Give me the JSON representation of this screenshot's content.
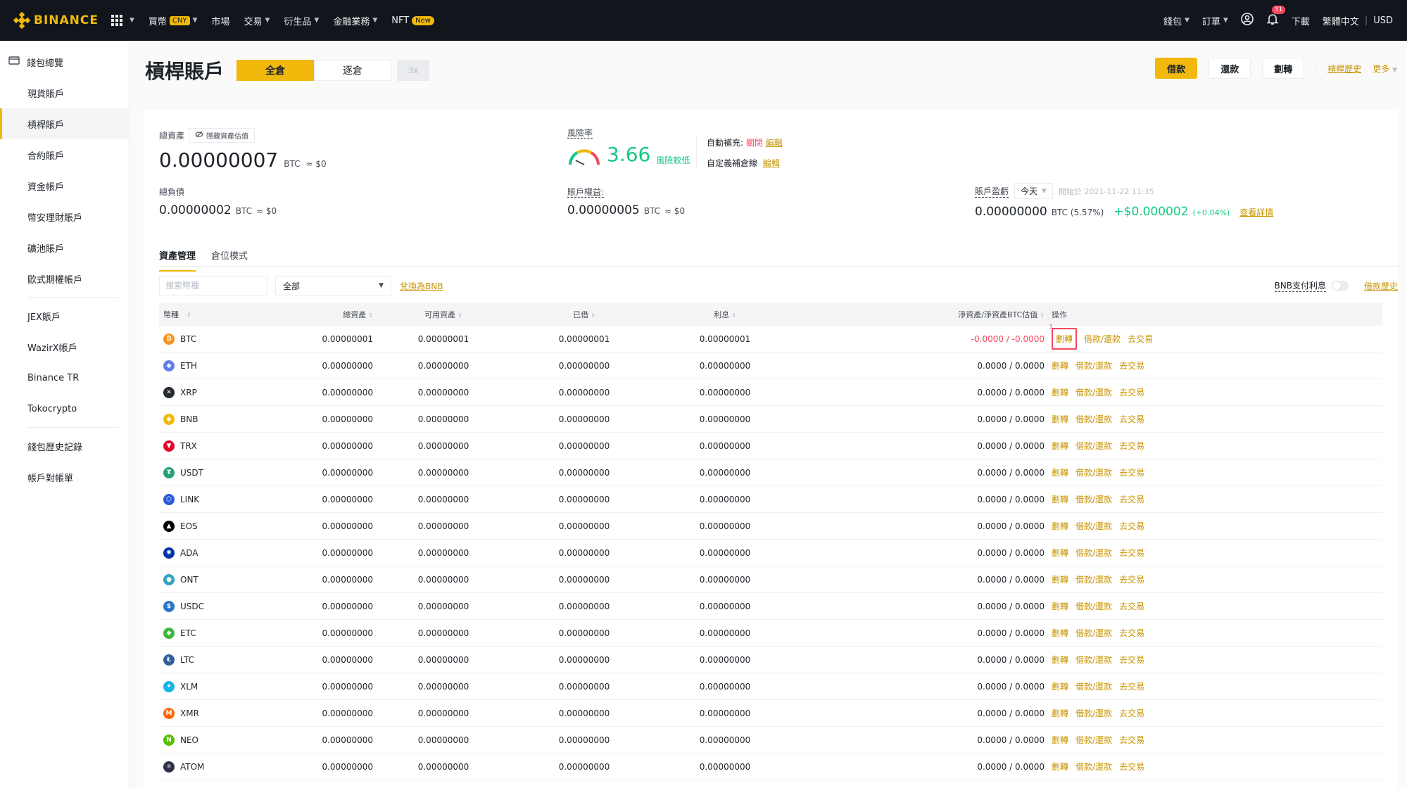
{
  "topbar": {
    "brand": "BINANCE",
    "nav": [
      {
        "label": "買幣",
        "tag": "CNY",
        "caret": true
      },
      {
        "label": "市場",
        "caret": false
      },
      {
        "label": "交易",
        "caret": true
      },
      {
        "label": "衍生品",
        "caret": true
      },
      {
        "label": "金融業務",
        "caret": true
      },
      {
        "label": "NFT",
        "tag": "New",
        "caret": false
      }
    ],
    "right": {
      "wallet": "錢包",
      "orders": "訂單",
      "notif_count": "31",
      "download": "下載",
      "language": "繁體中文",
      "divider": "|",
      "currency": "USD"
    }
  },
  "sidebar": {
    "overview": "錢包總覽",
    "items": [
      "現貨賬戶",
      "槓桿賬戶",
      "合約賬戶",
      "資金帳戶",
      "幣安理財賬戶",
      "礦池賬戶",
      "歐式期權帳戶",
      "JEX賬戶",
      "WazirX帳戶",
      "Binance TR",
      "Tokocrypto",
      "錢包歷史記錄",
      "帳戶對帳單"
    ]
  },
  "header": {
    "title": "槓桿賬戶",
    "modes": [
      "全倉",
      "逐倉",
      "3x"
    ],
    "actions": {
      "borrow": "借款",
      "repay": "還款",
      "transfer": "劃轉",
      "history": "槓桿歷史",
      "more": "更多"
    }
  },
  "summary": {
    "total_label": "總資產",
    "hide_label": "隱藏資產估值",
    "total_value": "0.00000007",
    "total_unit": "BTC",
    "total_fiat": "≈ $0",
    "risk_label": "風險率",
    "risk_value": "3.66",
    "risk_tag": "風險較低",
    "auto_label": "自動補充:",
    "auto_status": "關閉",
    "auto_edit": "編輯",
    "custom_label": "自定義補倉線",
    "custom_edit": "編輯",
    "debt_label": "總負債",
    "debt_value": "0.00000002",
    "debt_unit": "BTC",
    "debt_fiat": "≈ $0",
    "equity_label": "賬戶權益:",
    "equity_value": "0.00000005",
    "equity_unit": "BTC",
    "equity_fiat": "≈ $0",
    "pnl_label": "賬戶盈虧",
    "pnl_period": "今天",
    "pnl_start": "開始於 2021-11-22 11:35",
    "pnl_value": "0.00000000",
    "pnl_unit": "BTC (5.57%)",
    "pnl_fiat": "+$0.000002",
    "pnl_pct": "(+0.04%)",
    "pnl_detail": "查看詳情"
  },
  "tabs": [
    "資產管理",
    "倉位模式"
  ],
  "filters": {
    "search_placeholder": "搜索幣種",
    "select_value": "全部",
    "convert": "兌換為BNB",
    "bnb_interest": "BNB支付利息",
    "borrow_history": "借款歷史"
  },
  "table": {
    "headers": [
      "幣種",
      "總資產",
      "可用資產",
      "已借",
      "利息",
      "淨資產/淨資產BTC估值",
      "操作"
    ],
    "highlight_marker": "3",
    "actions": [
      "劃轉",
      "借款/還款",
      "去交易"
    ],
    "rows": [
      {
        "coin": "BTC",
        "icon": "btc-icon",
        "color": "#f7931a",
        "total": "0.00000001",
        "available": "0.00000001",
        "borrowed": "0.00000001",
        "interest": "0.00000001",
        "net": "-0.0000 / -0.0000"
      },
      {
        "coin": "ETH",
        "icon": "eth-icon",
        "color": "#627eea",
        "total": "0.00000000",
        "available": "0.00000000",
        "borrowed": "0.00000000",
        "interest": "0.00000000",
        "net": "0.0000 / 0.0000"
      },
      {
        "coin": "XRP",
        "icon": "xrp-icon",
        "color": "#23292f",
        "total": "0.00000000",
        "available": "0.00000000",
        "borrowed": "0.00000000",
        "interest": "0.00000000",
        "net": "0.0000 / 0.0000"
      },
      {
        "coin": "BNB",
        "icon": "bnb-icon",
        "color": "#f0b90b",
        "total": "0.00000000",
        "available": "0.00000000",
        "borrowed": "0.00000000",
        "interest": "0.00000000",
        "net": "0.0000 / 0.0000"
      },
      {
        "coin": "TRX",
        "icon": "trx-icon",
        "color": "#eb0029",
        "total": "0.00000000",
        "available": "0.00000000",
        "borrowed": "0.00000000",
        "interest": "0.00000000",
        "net": "0.0000 / 0.0000"
      },
      {
        "coin": "USDT",
        "icon": "usdt-icon",
        "color": "#26a17b",
        "total": "0.00000000",
        "available": "0.00000000",
        "borrowed": "0.00000000",
        "interest": "0.00000000",
        "net": "0.0000 / 0.0000"
      },
      {
        "coin": "LINK",
        "icon": "link-icon",
        "color": "#2a5ada",
        "total": "0.00000000",
        "available": "0.00000000",
        "borrowed": "0.00000000",
        "interest": "0.00000000",
        "net": "0.0000 / 0.0000"
      },
      {
        "coin": "EOS",
        "icon": "eos-icon",
        "color": "#000000",
        "total": "0.00000000",
        "available": "0.00000000",
        "borrowed": "0.00000000",
        "interest": "0.00000000",
        "net": "0.0000 / 0.0000"
      },
      {
        "coin": "ADA",
        "icon": "ada-icon",
        "color": "#0033ad",
        "total": "0.00000000",
        "available": "0.00000000",
        "borrowed": "0.00000000",
        "interest": "0.00000000",
        "net": "0.0000 / 0.0000"
      },
      {
        "coin": "ONT",
        "icon": "ont-icon",
        "color": "#32a4be",
        "total": "0.00000000",
        "available": "0.00000000",
        "borrowed": "0.00000000",
        "interest": "0.00000000",
        "net": "0.0000 / 0.0000"
      },
      {
        "coin": "USDC",
        "icon": "usdc-icon",
        "color": "#2775ca",
        "total": "0.00000000",
        "available": "0.00000000",
        "borrowed": "0.00000000",
        "interest": "0.00000000",
        "net": "0.0000 / 0.0000"
      },
      {
        "coin": "ETC",
        "icon": "etc-icon",
        "color": "#3ab83a",
        "total": "0.00000000",
        "available": "0.00000000",
        "borrowed": "0.00000000",
        "interest": "0.00000000",
        "net": "0.0000 / 0.0000"
      },
      {
        "coin": "LTC",
        "icon": "ltc-icon",
        "color": "#345d9d",
        "total": "0.00000000",
        "available": "0.00000000",
        "borrowed": "0.00000000",
        "interest": "0.00000000",
        "net": "0.0000 / 0.0000"
      },
      {
        "coin": "XLM",
        "icon": "xlm-icon",
        "color": "#14b6e7",
        "total": "0.00000000",
        "available": "0.00000000",
        "borrowed": "0.00000000",
        "interest": "0.00000000",
        "net": "0.0000 / 0.0000"
      },
      {
        "coin": "XMR",
        "icon": "xmr-icon",
        "color": "#ff6600",
        "total": "0.00000000",
        "available": "0.00000000",
        "borrowed": "0.00000000",
        "interest": "0.00000000",
        "net": "0.0000 / 0.0000"
      },
      {
        "coin": "NEO",
        "icon": "neo-icon",
        "color": "#58bf00",
        "total": "0.00000000",
        "available": "0.00000000",
        "borrowed": "0.00000000",
        "interest": "0.00000000",
        "net": "0.0000 / 0.0000"
      },
      {
        "coin": "ATOM",
        "icon": "atom-icon",
        "color": "#2e3148",
        "total": "0.00000000",
        "available": "0.00000000",
        "borrowed": "0.00000000",
        "interest": "0.00000000",
        "net": "0.0000 / 0.0000"
      }
    ]
  }
}
